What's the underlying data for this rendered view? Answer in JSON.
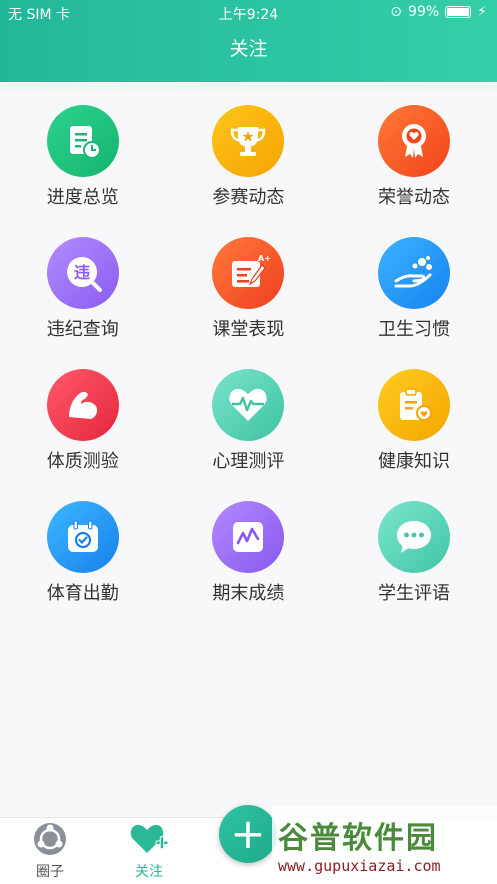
{
  "status_bar": {
    "carrier": "无 SIM 卡",
    "time": "上午9:24",
    "battery": "99%"
  },
  "header": {
    "title": "关注"
  },
  "grid": [
    {
      "label": "进度总览",
      "icon": "schedule-icon",
      "color1": "#2fd38c",
      "color2": "#12b36f"
    },
    {
      "label": "参赛动态",
      "icon": "trophy-icon",
      "color1": "#ffc61a",
      "color2": "#f5a300"
    },
    {
      "label": "荣誉动态",
      "icon": "medal-icon",
      "color1": "#ff7a38",
      "color2": "#f2431b"
    },
    {
      "label": "违纪查询",
      "icon": "violation-search-icon",
      "color1": "#b28cff",
      "color2": "#8a5cf0"
    },
    {
      "label": "课堂表现",
      "icon": "grade-edit-icon",
      "color1": "#ff7a3a",
      "color2": "#ef3e20"
    },
    {
      "label": "卫生习惯",
      "icon": "hand-wash-icon",
      "color1": "#3cb3ff",
      "color2": "#1682ef"
    },
    {
      "label": "体质测验",
      "icon": "muscle-icon",
      "color1": "#ff5a6a",
      "color2": "#e5263d"
    },
    {
      "label": "心理测评",
      "icon": "heartbeat-icon",
      "color1": "#7ae3c9",
      "color2": "#3ec4a2"
    },
    {
      "label": "健康知识",
      "icon": "health-clipboard-icon",
      "color1": "#ffcc1f",
      "color2": "#f4a500"
    },
    {
      "label": "体育出勤",
      "icon": "attendance-calendar-icon",
      "color1": "#3db7ff",
      "color2": "#1780ec"
    },
    {
      "label": "期末成绩",
      "icon": "score-chart-icon",
      "color1": "#b389ff",
      "color2": "#8958ee"
    },
    {
      "label": "学生评语",
      "icon": "comment-bubble-icon",
      "color1": "#7de6cc",
      "color2": "#3fc6a5"
    }
  ],
  "tabbar": {
    "circle_label": "圈子",
    "follow_label": "关注",
    "active_color": "#2bb895"
  },
  "fab": {
    "label": "+"
  },
  "watermark": {
    "main": "谷普软件园",
    "sub": "www.gupuxiazai.com"
  }
}
